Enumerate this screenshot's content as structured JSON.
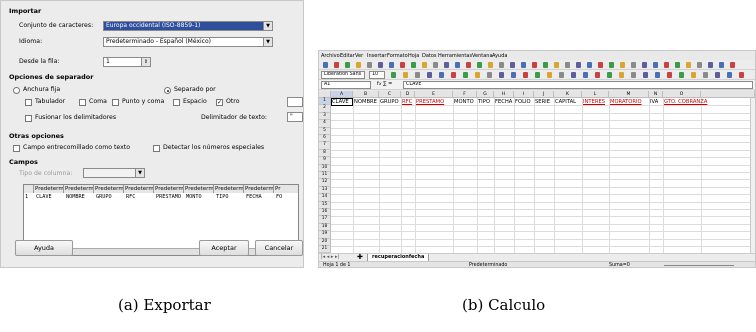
{
  "dialog": {
    "section_import": "Importar",
    "charset_label": "Conjunto de caracteres:",
    "charset_value": "Europa occidental (ISO-8859-1)",
    "language_label": "Idioma:",
    "language_value": "Predeterminado - Español (México)",
    "from_row_label": "Desde la fila:",
    "from_row_value": "1",
    "section_separator": "Opciones de separador",
    "fixed_width": "Anchura fija",
    "separated_by": "Separado por",
    "tab": "Tabulador",
    "comma": "Coma",
    "semicolon": "Punto y coma",
    "space": "Espacio",
    "other": "Otro",
    "merge": "Fusionar los delimitadores",
    "text_delim_label": "Delimitador de texto:",
    "text_delim_value": "\"",
    "section_other": "Otras opciones",
    "quoted_as_text": "Campo entrecomillado como texto",
    "detect_special": "Detectar los números especiales",
    "section_fields": "Campos",
    "column_type_label": "Tipo de columna:",
    "preview_headers": [
      "Predeterm",
      "Predeterm",
      "Predeterm",
      "Predeterm",
      "Predetermi",
      "Predeterm",
      "Predeterm",
      "Predeterm",
      "Pr"
    ],
    "preview_row_num": "1",
    "preview_row": [
      "CLAVE",
      "NOMBRE",
      "GRUPO",
      "RFC",
      "PRESTAMO",
      "MONTO",
      "TIPO",
      "FECHA",
      "FO"
    ],
    "help_button": "Ayuda",
    "ok_button": "Aceptar",
    "cancel_button": "Cancelar"
  },
  "calc": {
    "menu": [
      "Archivo",
      "Editar",
      "Ver",
      "Insertar",
      "Formato",
      "Hoja",
      "Datos",
      "Herramientas",
      "Ventana",
      "Ayuda"
    ],
    "font_name": "Liberation Sans",
    "font_size": "10",
    "cell_ref": "A1",
    "formula_icons": "f𝑥 ∑ =",
    "formula_value": "CLAVE",
    "columns": [
      "A",
      "B",
      "C",
      "D",
      "E",
      "F",
      "G",
      "H",
      "I",
      "J",
      "K",
      "L",
      "M",
      "N",
      "O"
    ],
    "rows": [
      "1",
      "2",
      "3",
      "4",
      "5",
      "6",
      "7",
      "8",
      "9",
      "10",
      "11",
      "12",
      "13",
      "14",
      "15",
      "16",
      "17",
      "18",
      "19",
      "20",
      "21"
    ],
    "row1": [
      "CLAVE",
      "NOMBRE",
      "GRUPO",
      "RFC",
      "PRESTAMO",
      "MONTO",
      "TIPO",
      "FECHA",
      "FOLIO",
      "SERIE",
      "CAPITAL",
      "INTERES",
      "MORATORIO",
      "IVA",
      "GTO. COBRANZA"
    ],
    "sheet_tab": "recuperacionfecha",
    "status_sheet": "Hoja 1 de 1",
    "status_style": "Predeterminado",
    "status_sum": "Suma=0"
  },
  "captions": {
    "a": "(a)  Exportar",
    "b": "(b)  Calculo"
  }
}
